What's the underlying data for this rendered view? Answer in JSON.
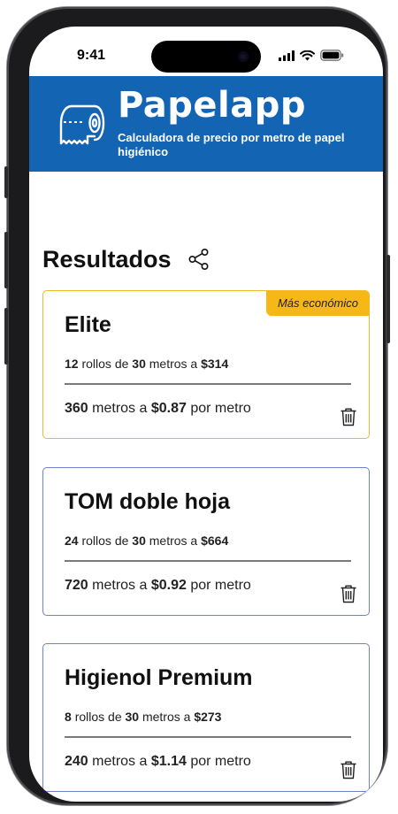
{
  "status_bar": {
    "time": "9:41"
  },
  "header": {
    "title": "Papelapp",
    "subtitle": "Calculadora de precio por metro de papel higiénico"
  },
  "results": {
    "title": "Resultados",
    "badge": "Más económico",
    "labels": {
      "rolls": "rollos de",
      "meters_at": "metros a",
      "meters": "metros a",
      "per_meter": "por metro"
    },
    "items": [
      {
        "name": "Elite",
        "rolls": "12",
        "meters_per_roll": "30",
        "price": "$314",
        "total_meters": "360",
        "price_per_meter": "$0.87"
      },
      {
        "name": "TOM doble hoja",
        "rolls": "24",
        "meters_per_roll": "30",
        "price": "$664",
        "total_meters": "720",
        "price_per_meter": "$0.92"
      },
      {
        "name": "Higienol Premium",
        "rolls": "8",
        "meters_per_roll": "30",
        "price": "$273",
        "total_meters": "240",
        "price_per_meter": "$1.14"
      }
    ]
  },
  "colors": {
    "header": "#1464b4",
    "badge": "#f6b816",
    "cheapest_border": "#f0b92a",
    "card_border": "#6b83c8"
  },
  "icons": [
    "toilet-paper-icon",
    "share-icon",
    "trash-icon",
    "signal-icon",
    "wifi-icon",
    "battery-icon"
  ]
}
